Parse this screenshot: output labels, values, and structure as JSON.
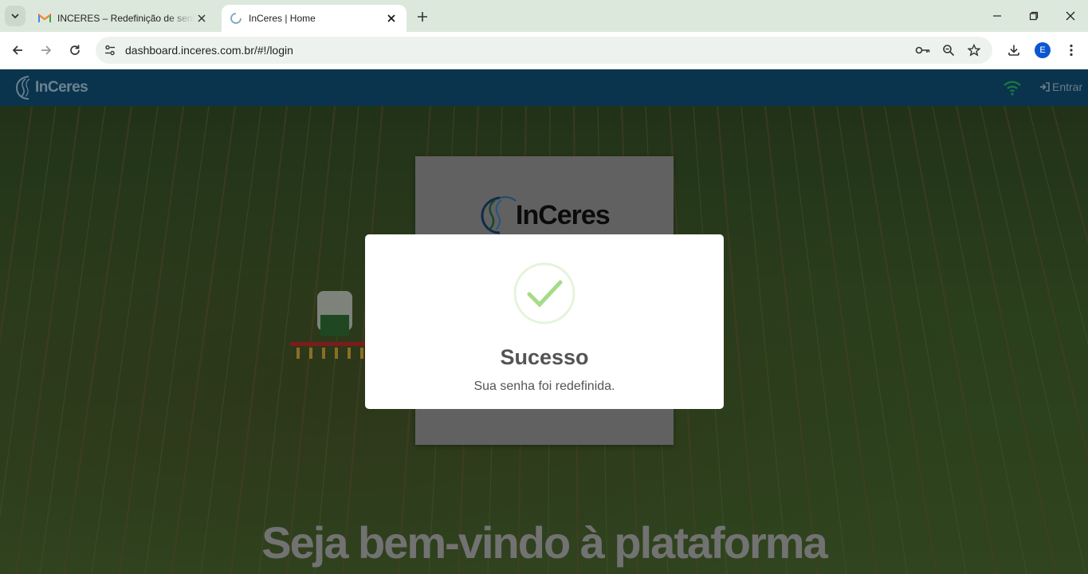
{
  "browser": {
    "tabs": [
      {
        "title": "INCERES – Redefinição de senha",
        "favicon": "gmail-icon",
        "active": false
      },
      {
        "title": "InCeres | Home",
        "favicon": "loading-spinner-icon",
        "active": true
      }
    ],
    "url": "dashboard.inceres.com.br/#!/login",
    "profile_initial": "E"
  },
  "navbar": {
    "brand": "InCeres",
    "login_label": "Entrar"
  },
  "login_card": {
    "logo_text": "InCeres"
  },
  "welcome_text": "Seja bem-vindo à plataforma",
  "modal": {
    "title": "Sucesso",
    "message": "Sua senha foi redefinida.",
    "icon": "check-icon",
    "accent_color": "#a5dc86"
  },
  "colors": {
    "navbar": "#0f4d72",
    "wifi": "#27ae60"
  }
}
